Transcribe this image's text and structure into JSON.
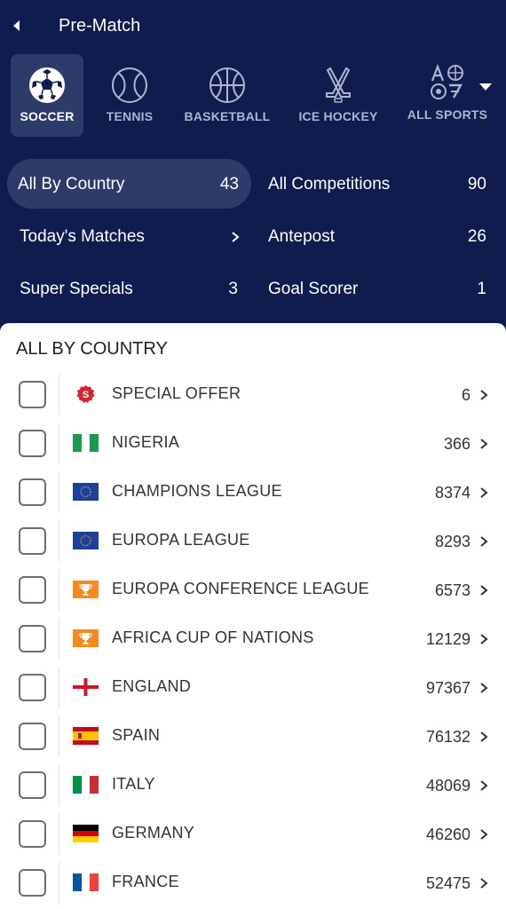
{
  "header": {
    "title": "Pre-Match"
  },
  "sports": [
    {
      "label": "SOCCER",
      "icon": "soccer-ball-icon",
      "active": true
    },
    {
      "label": "TENNIS",
      "icon": "tennis-ball-icon",
      "active": false
    },
    {
      "label": "BASKETBALL",
      "icon": "basketball-icon",
      "active": false
    },
    {
      "label": "ICE HOCKEY",
      "icon": "hockey-sticks-icon",
      "active": false
    },
    {
      "label": "ALL SPORTS",
      "icon": "all-sports-icon",
      "active": false
    }
  ],
  "filters": [
    {
      "label": "All By Country",
      "count": "43",
      "active": true
    },
    {
      "label": "All Competitions",
      "count": "90",
      "active": false
    },
    {
      "label": "Today's Matches",
      "count": "",
      "active": false
    },
    {
      "label": "Antepost",
      "count": "26",
      "active": false
    },
    {
      "label": "Super Specials",
      "count": "3",
      "active": false
    },
    {
      "label": "Goal Scorer",
      "count": "1",
      "active": false
    }
  ],
  "list": {
    "title": "ALL BY COUNTRY",
    "items": [
      {
        "label": "SPECIAL OFFER",
        "count": "6",
        "icon": "special-offer-badge-icon"
      },
      {
        "label": "NIGERIA",
        "count": "366",
        "icon": "nigeria-flag-icon"
      },
      {
        "label": "CHAMPIONS LEAGUE",
        "count": "8374",
        "icon": "eu-flag-icon"
      },
      {
        "label": "EUROPA LEAGUE",
        "count": "8293",
        "icon": "eu-flag-icon"
      },
      {
        "label": "EUROPA CONFERENCE LEAGUE",
        "count": "6573",
        "icon": "trophy-icon"
      },
      {
        "label": "AFRICA CUP OF NATIONS",
        "count": "12129",
        "icon": "trophy-icon"
      },
      {
        "label": "ENGLAND",
        "count": "97367",
        "icon": "england-flag-icon"
      },
      {
        "label": "SPAIN",
        "count": "76132",
        "icon": "spain-flag-icon"
      },
      {
        "label": "ITALY",
        "count": "48069",
        "icon": "italy-flag-icon"
      },
      {
        "label": "GERMANY",
        "count": "46260",
        "icon": "germany-flag-icon"
      },
      {
        "label": "FRANCE",
        "count": "52475",
        "icon": "france-flag-icon"
      }
    ]
  },
  "colors": {
    "header_bg": "#0f1c4d",
    "active_bg": "#2d3b6b",
    "sheet_bg": "#ffffff",
    "badge_red": "#d7262b",
    "trophy_orange": "#f5891f"
  }
}
